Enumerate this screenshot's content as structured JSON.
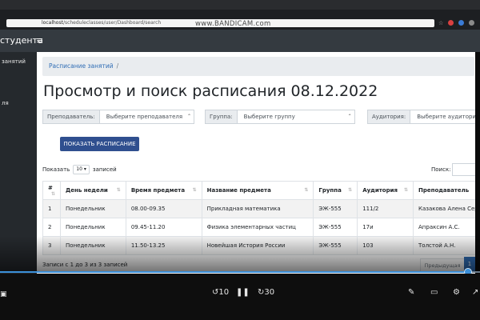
{
  "browser": {
    "url_host": "localhost",
    "url_path": "/scheduleclasses/user/Dashboard/search",
    "watermark": "www.BANDICAM.com"
  },
  "app": {
    "brand": "студента",
    "menu_icon": "hamburger-icon"
  },
  "sidebar": {
    "items": [
      {
        "label": "занятий"
      },
      {
        "label": "ля"
      }
    ]
  },
  "breadcrumb": {
    "item": "Расписание занятий",
    "separator": "/"
  },
  "page": {
    "title": "Просмотр и поиск расписания 08.12.2022"
  },
  "filters": {
    "teacher": {
      "label": "Преподаватель:",
      "value": "Выберите преподавателя"
    },
    "group": {
      "label": "Группа:",
      "value": "Выберите группу"
    },
    "room": {
      "label": "Аудитория:",
      "value": "Выберите аудиторию"
    }
  },
  "actions": {
    "show_schedule": "ПОКАЗАТЬ РАСПИСАНИЕ"
  },
  "table_controls": {
    "show_label": "Показать",
    "page_length": "10",
    "entries_label": "записей",
    "search_label": "Поиск:"
  },
  "table": {
    "columns": [
      "#",
      "День недели",
      "Время предмета",
      "Название предмета",
      "Группа",
      "Аудитория",
      "Преподаватель"
    ],
    "rows": [
      [
        "1",
        "Понедельник",
        "08.00-09.35",
        "Прикладная математика",
        "ЭЖ-555",
        "111/2",
        "Казакова Алена Серг"
      ],
      [
        "2",
        "Понедельник",
        "09.45-11.20",
        "Физика элементарных частиц",
        "ЭЖ-555",
        "17и",
        "Апраксин А.С."
      ],
      [
        "3",
        "Понедельник",
        "11.50-13.25",
        "Новейшая История России",
        "ЭЖ-555",
        "103",
        "Толстой А.Н."
      ]
    ]
  },
  "pagination": {
    "info": "Записи с 1 до 3 из 3 записей",
    "previous": "Предыдущая",
    "current": "1"
  },
  "player": {
    "progress_fraction": 0.975,
    "rewind_label": "10",
    "forward_label": "30",
    "colors": {
      "accent": "#3b8fd8"
    }
  },
  "colors": {
    "header": "#343a40",
    "primary_button": "#2f4f8f",
    "link": "#2f6db5"
  }
}
